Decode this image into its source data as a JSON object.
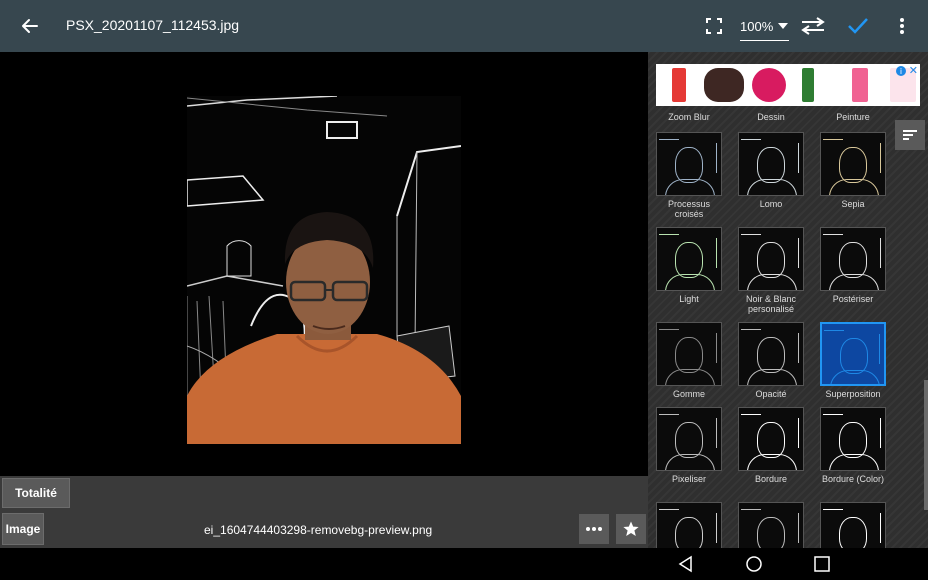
{
  "toolbar": {
    "file_name": "PSX_20201107_112453.jpg",
    "zoom": "100%",
    "icons": [
      "back-arrow-icon",
      "fullscreen-icon",
      "swap-icon",
      "check-icon",
      "more-vert-icon"
    ],
    "accent": "#2196f3",
    "background": "#37474f"
  },
  "layer_controls": {
    "totalite_label": "Totalité",
    "image_label": "Image",
    "layer_file_name": "ei_1604744403298-removebg-preview.png",
    "icons": [
      "more-horiz-icon",
      "star-icon"
    ]
  },
  "effects_panel": {
    "cut_labels": [
      "Zoom Blur",
      "Dessin",
      "Peinture"
    ],
    "tiles": [
      {
        "label": "Processus croisés",
        "tint": "#9fb3c8"
      },
      {
        "label": "Lomo",
        "tint": "#cfd8dc"
      },
      {
        "label": "Sepia",
        "tint": "#d8c79a"
      },
      {
        "label": "Light",
        "tint": "#b9e3b0"
      },
      {
        "label": "Noir & Blanc personalisé",
        "tint": "#e0e0e0"
      },
      {
        "label": "Postériser",
        "tint": "#e0e0e0"
      },
      {
        "label": "Gomme",
        "tint": "#8a8a8a"
      },
      {
        "label": "Opacité",
        "tint": "#bdbdbd"
      },
      {
        "label": "Superposition",
        "tint": "#1e88e5",
        "selected": true
      },
      {
        "label": "Pixeliser",
        "tint": "#bdbdbd"
      },
      {
        "label": "Bordure",
        "tint": "#ffffff"
      },
      {
        "label": "Bordure (Color)",
        "tint": "#ffffff"
      },
      {
        "label": "",
        "tint": "#cfcfcf"
      },
      {
        "label": "",
        "tint": "#bdbdbd"
      },
      {
        "label": "",
        "tint": "#ffffff"
      }
    ],
    "icons": [
      "sort-icon"
    ]
  },
  "ad": {
    "icons": [
      "ad-info-icon",
      "ad-close-icon"
    ]
  },
  "navigation": {
    "icons": [
      "nav-back-icon",
      "nav-home-icon",
      "nav-recents-icon"
    ]
  }
}
